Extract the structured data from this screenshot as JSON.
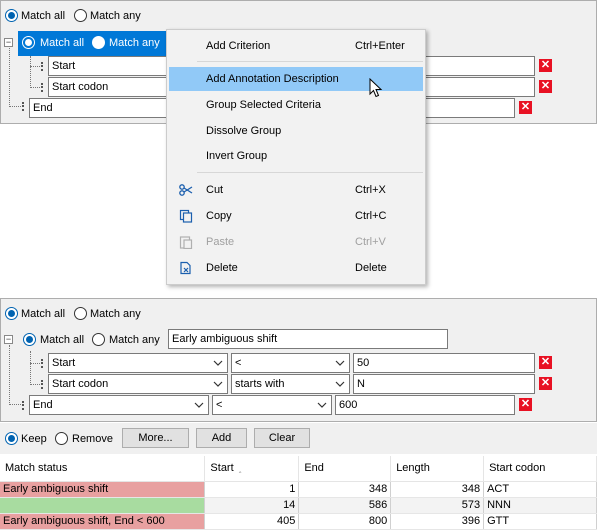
{
  "top_builder": {
    "match_all_label": "Match all",
    "match_any_label": "Match any",
    "group": {
      "match_all_label": "Match all",
      "match_any_label": "Match any"
    },
    "rows": [
      {
        "field": "Start"
      },
      {
        "field": "Start codon"
      }
    ],
    "end_row": {
      "field": "End"
    }
  },
  "context_menu": {
    "items": [
      {
        "label": "Add Criterion",
        "shortcut": "Ctrl+Enter"
      },
      {
        "label": "Add Annotation Description",
        "shortcut": ""
      },
      {
        "label": "Group Selected Criteria",
        "shortcut": ""
      },
      {
        "label": "Dissolve Group",
        "shortcut": ""
      },
      {
        "label": "Invert Group",
        "shortcut": ""
      },
      {
        "label": "Cut",
        "shortcut": "Ctrl+X",
        "icon": "scissors-icon"
      },
      {
        "label": "Copy",
        "shortcut": "Ctrl+C",
        "icon": "copy-icon"
      },
      {
        "label": "Paste",
        "shortcut": "Ctrl+V",
        "icon": "paste-icon",
        "disabled": true
      },
      {
        "label": "Delete",
        "shortcut": "Delete",
        "icon": "delete-icon"
      }
    ]
  },
  "bottom_builder": {
    "match_all_label": "Match all",
    "match_any_label": "Match any",
    "group": {
      "match_all_label": "Match all",
      "match_any_label": "Match any",
      "description": "Early ambiguous shift"
    },
    "rows": [
      {
        "field": "Start",
        "operator": "<",
        "value": "50"
      },
      {
        "field": "Start codon",
        "operator": "starts with",
        "value": "N"
      }
    ],
    "end_row": {
      "field": "End",
      "operator": "<",
      "value": "600"
    }
  },
  "actions": {
    "keep_label": "Keep",
    "remove_label": "Remove",
    "more_label": "More...",
    "add_label": "Add",
    "clear_label": "Clear"
  },
  "table": {
    "columns": [
      "Match status",
      "Start",
      "End",
      "Length",
      "Start codon"
    ],
    "sort_indicator": "‸",
    "rows": [
      {
        "status": "Early ambiguous shift",
        "start": "1",
        "end": "348",
        "length": "348",
        "codon": "ACT",
        "color": "#e8a0a0"
      },
      {
        "status": "",
        "start": "14",
        "end": "586",
        "length": "573",
        "codon": "NNN",
        "color": "#a8dca0"
      },
      {
        "status": "Early ambiguous shift, End < 600",
        "start": "405",
        "end": "800",
        "length": "396",
        "codon": "GTT",
        "color": "#e8a0a0"
      }
    ]
  },
  "colors": {
    "selection": "#0078d7",
    "menu_highlight": "#91c9f7",
    "delete_red": "#e81123",
    "match_red": "#e8a0a0",
    "match_green": "#a8dca0"
  }
}
